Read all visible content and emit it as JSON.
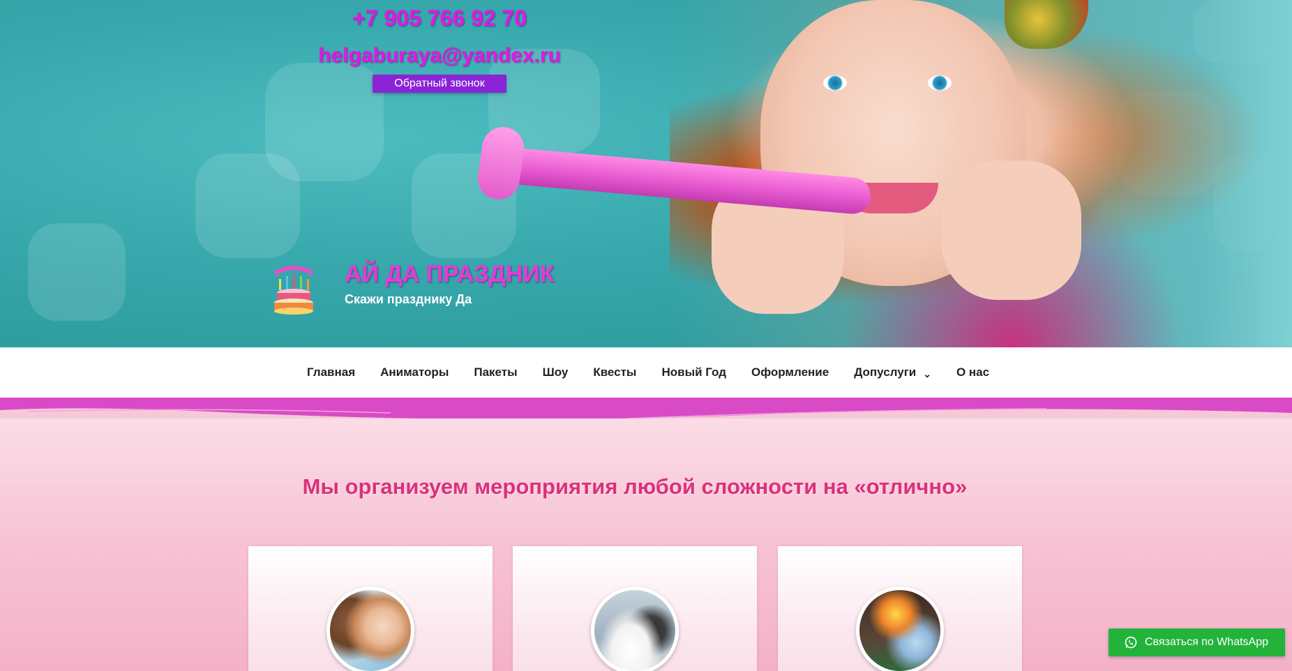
{
  "header": {
    "phone": "+7 905 766 92 70",
    "email": "helgaburaya@yandex.ru",
    "callback_label": "Обратный звонок",
    "site_title": "АЙ ДА ПРАЗДНИК",
    "tagline": "Скажи празднику Да",
    "logo_icon": "birthday-cake-icon"
  },
  "nav": {
    "items": [
      {
        "label": "Главная"
      },
      {
        "label": "Аниматоры"
      },
      {
        "label": "Пакеты"
      },
      {
        "label": "Шоу"
      },
      {
        "label": "Квесты"
      },
      {
        "label": "Новый Год"
      },
      {
        "label": "Оформление"
      },
      {
        "label": "Допуслуги",
        "has_submenu": true
      },
      {
        "label": "О нас"
      }
    ],
    "submenu_icon": "chevron-down-icon"
  },
  "main": {
    "headline": "Мы организуем мероприятия любой сложности на «отлично»",
    "cards": [
      {
        "image": "kids-party-photo"
      },
      {
        "image": "wedding-photo"
      },
      {
        "image": "fire-show-photo"
      }
    ]
  },
  "whatsapp": {
    "label": "Связаться по WhatsApp",
    "icon": "whatsapp-icon",
    "color": "#23b33a"
  },
  "colors": {
    "accent_magenta": "#e018e6",
    "callback_purple": "#8a24d6",
    "headline_pink": "#d9317a",
    "wave_pink": "#d94bc6"
  }
}
